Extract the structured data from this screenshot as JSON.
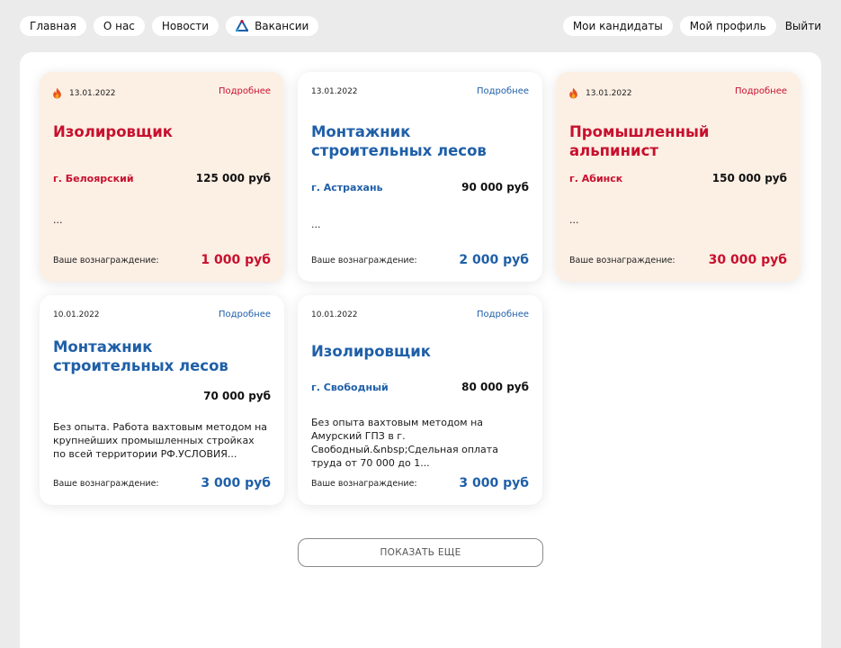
{
  "nav": {
    "left": [
      {
        "label": "Главная"
      },
      {
        "label": "О нас"
      },
      {
        "label": "Новости"
      },
      {
        "label": "Вакансии",
        "icon": "logo-icon"
      }
    ],
    "right": [
      {
        "label": "Мои кандидаты"
      },
      {
        "label": "Мой профиль"
      }
    ],
    "logout": "Выйти"
  },
  "colors": {
    "accent_red": "#c8102e",
    "accent_blue": "#1f5fa8",
    "hot_card_bg": "#fcefe4",
    "page_bg": "#ebebeb"
  },
  "cards": [
    {
      "hot": true,
      "date": "13.01.2022",
      "more": "Подробнее",
      "title": "Изолировщик",
      "city": "г. Белоярский",
      "salary": "125 000 руб",
      "description": "...",
      "reward_label": "Ваше вознаграждение:",
      "reward": "1 000 руб"
    },
    {
      "hot": false,
      "date": "13.01.2022",
      "more": "Подробнее",
      "title": "Монтажник строительных лесов",
      "city": "г. Астрахань",
      "salary": "90 000 руб",
      "description": "...",
      "reward_label": "Ваше вознаграждение:",
      "reward": "2 000 руб"
    },
    {
      "hot": true,
      "date": "13.01.2022",
      "more": "Подробнее",
      "title": "Промышленный альпинист",
      "city": "г. Абинск",
      "salary": "150 000 руб",
      "description": "...",
      "reward_label": "Ваше вознаграждение:",
      "reward": "30 000 руб"
    },
    {
      "hot": false,
      "date": "10.01.2022",
      "more": "Подробнее",
      "title": "Монтажник строительных лесов",
      "city": "",
      "salary": "70 000 руб",
      "description": "Без опыта. Работа вахтовым методом на крупнейших промышленных стройках по всей территории РФ.УСЛОВИЯ...",
      "reward_label": "Ваше вознаграждение:",
      "reward": "3 000 руб"
    },
    {
      "hot": false,
      "date": "10.01.2022",
      "more": "Подробнее",
      "title": "Изолировщик",
      "city": "г. Свободный",
      "salary": "80 000 руб",
      "description": "Без опыта вахтовым методом на Амурский ГПЗ в г. Свободный.&nbsp;Сдельная оплата труда от 70 000 до 1...",
      "reward_label": "Ваше вознаграждение:",
      "reward": "3 000 руб"
    }
  ],
  "show_more": "ПОКАЗАТЬ ЕЩЕ"
}
